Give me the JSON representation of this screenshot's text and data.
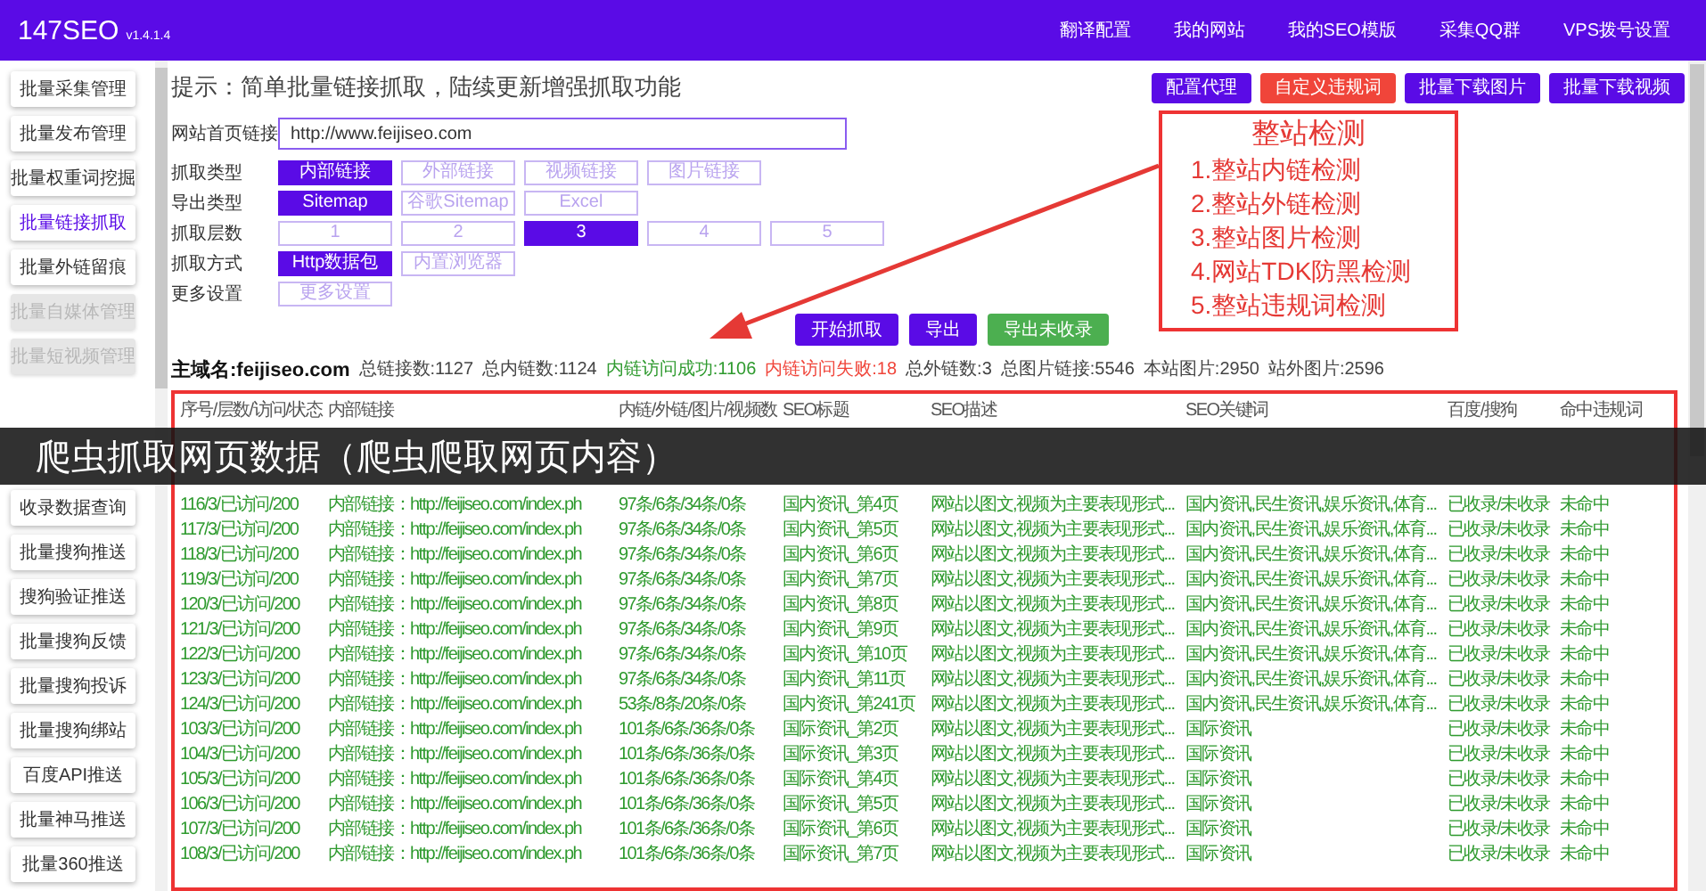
{
  "app": {
    "name": "147SEO",
    "version": "v1.4.1.4"
  },
  "top_nav": [
    "翻译配置",
    "我的网站",
    "我的SEO模版",
    "采集QQ群",
    "VPS拨号设置"
  ],
  "sidebar": {
    "groups": [
      [
        {
          "label": "批量采集管理",
          "selected": false,
          "disabled": false
        },
        {
          "label": "批量发布管理",
          "selected": false,
          "disabled": false
        },
        {
          "label": "批量权重词挖掘",
          "selected": false,
          "disabled": false
        },
        {
          "label": "批量链接抓取",
          "selected": true,
          "disabled": false
        },
        {
          "label": "批量外链留痕",
          "selected": false,
          "disabled": false
        },
        {
          "label": "批量自媒体管理",
          "selected": false,
          "disabled": true
        },
        {
          "label": "批量短视频管理",
          "selected": false,
          "disabled": true
        }
      ],
      [
        {
          "label": "收录数据查询",
          "selected": false,
          "disabled": false
        },
        {
          "label": "批量搜狗推送",
          "selected": false,
          "disabled": false
        },
        {
          "label": "搜狗验证推送",
          "selected": false,
          "disabled": false
        },
        {
          "label": "批量搜狗反馈",
          "selected": false,
          "disabled": false
        },
        {
          "label": "批量搜狗投诉",
          "selected": false,
          "disabled": false
        },
        {
          "label": "批量搜狗绑站",
          "selected": false,
          "disabled": false
        },
        {
          "label": "百度API推送",
          "selected": false,
          "disabled": false
        },
        {
          "label": "批量神马推送",
          "selected": false,
          "disabled": false
        },
        {
          "label": "批量360推送",
          "selected": false,
          "disabled": false
        }
      ]
    ]
  },
  "hint": "提示：简单批量链接抓取，陆续更新增强抓取功能",
  "toolbar": [
    {
      "label": "配置代理",
      "kind": "primary"
    },
    {
      "label": "自定义违规词",
      "kind": "danger"
    },
    {
      "label": "批量下载图片",
      "kind": "primary"
    },
    {
      "label": "批量下载视频",
      "kind": "primary"
    }
  ],
  "url_field": {
    "label": "网站首页链接",
    "value": "http://www.feijiseo.com"
  },
  "options": [
    {
      "label": "抓取类型",
      "choices": [
        {
          "label": "内部链接",
          "selected": true
        },
        {
          "label": "外部链接",
          "selected": false
        },
        {
          "label": "视频链接",
          "selected": false
        },
        {
          "label": "图片链接",
          "selected": false
        }
      ]
    },
    {
      "label": "导出类型",
      "choices": [
        {
          "label": "Sitemap",
          "selected": true
        },
        {
          "label": "谷歌Sitemap",
          "selected": false
        },
        {
          "label": "Excel",
          "selected": false
        }
      ]
    },
    {
      "label": "抓取层数",
      "choices": [
        {
          "label": "1",
          "selected": false
        },
        {
          "label": "2",
          "selected": false
        },
        {
          "label": "3",
          "selected": true
        },
        {
          "label": "4",
          "selected": false
        },
        {
          "label": "5",
          "selected": false
        }
      ]
    },
    {
      "label": "抓取方式",
      "choices": [
        {
          "label": "Http数据包",
          "selected": true
        },
        {
          "label": "内置浏览器",
          "selected": false
        }
      ]
    },
    {
      "label": "更多设置",
      "choices": [
        {
          "label": "更多设置",
          "selected": false
        }
      ]
    }
  ],
  "actions": [
    {
      "label": "开始抓取",
      "kind": "primary"
    },
    {
      "label": "导出",
      "kind": "primary"
    },
    {
      "label": "导出未收录",
      "kind": "success"
    }
  ],
  "stats": [
    {
      "text": "主域名:feijiseo.com",
      "kind": "domain"
    },
    {
      "text": "总链接数:1127",
      "kind": "normal"
    },
    {
      "text": "总内链数:1124",
      "kind": "normal"
    },
    {
      "text": "内链访问成功:1106",
      "kind": "success"
    },
    {
      "text": "内链访问失败:18",
      "kind": "fail"
    },
    {
      "text": "总外链数:3",
      "kind": "normal"
    },
    {
      "text": "总图片链接:5546",
      "kind": "normal"
    },
    {
      "text": "本站图片:2950",
      "kind": "normal"
    },
    {
      "text": "站外图片:2596",
      "kind": "normal"
    }
  ],
  "annotation": {
    "title": "整站检测",
    "items": [
      "1.整站内链检测",
      "2.整站外链检测",
      "3.整站图片检测",
      "4.网站TDK防黑检测",
      "5.整站违规词检测"
    ]
  },
  "caption": "爬虫抓取网页数据（爬虫爬取网页内容）",
  "table": {
    "columns": [
      "序号/层数/访问/状态",
      "内部链接",
      "内链/外链/图片/视频数",
      "SEO标题",
      "SEO描述",
      "SEO关键词",
      "百度/搜狗",
      "命中违规词"
    ],
    "rows": [
      [
        "116/3/已访问/200",
        "内部链接：http://feijiseo.com/index.ph",
        "97条/6条/34条/0条",
        "国内资讯_第4页",
        "网站以图文,视频为主要表现形式...",
        "国内资讯,民生资讯,娱乐资讯,体育...",
        "已收录/未收录",
        "未命中"
      ],
      [
        "117/3/已访问/200",
        "内部链接：http://feijiseo.com/index.ph",
        "97条/6条/34条/0条",
        "国内资讯_第5页",
        "网站以图文,视频为主要表现形式...",
        "国内资讯,民生资讯,娱乐资讯,体育...",
        "已收录/未收录",
        "未命中"
      ],
      [
        "118/3/已访问/200",
        "内部链接：http://feijiseo.com/index.ph",
        "97条/6条/34条/0条",
        "国内资讯_第6页",
        "网站以图文,视频为主要表现形式...",
        "国内资讯,民生资讯,娱乐资讯,体育...",
        "已收录/未收录",
        "未命中"
      ],
      [
        "119/3/已访问/200",
        "内部链接：http://feijiseo.com/index.ph",
        "97条/6条/34条/0条",
        "国内资讯_第7页",
        "网站以图文,视频为主要表现形式...",
        "国内资讯,民生资讯,娱乐资讯,体育...",
        "已收录/未收录",
        "未命中"
      ],
      [
        "120/3/已访问/200",
        "内部链接：http://feijiseo.com/index.ph",
        "97条/6条/34条/0条",
        "国内资讯_第8页",
        "网站以图文,视频为主要表现形式...",
        "国内资讯,民生资讯,娱乐资讯,体育...",
        "已收录/未收录",
        "未命中"
      ],
      [
        "121/3/已访问/200",
        "内部链接：http://feijiseo.com/index.ph",
        "97条/6条/34条/0条",
        "国内资讯_第9页",
        "网站以图文,视频为主要表现形式...",
        "国内资讯,民生资讯,娱乐资讯,体育...",
        "已收录/未收录",
        "未命中"
      ],
      [
        "122/3/已访问/200",
        "内部链接：http://feijiseo.com/index.ph",
        "97条/6条/34条/0条",
        "国内资讯_第10页",
        "网站以图文,视频为主要表现形式...",
        "国内资讯,民生资讯,娱乐资讯,体育...",
        "已收录/未收录",
        "未命中"
      ],
      [
        "123/3/已访问/200",
        "内部链接：http://feijiseo.com/index.ph",
        "97条/6条/34条/0条",
        "国内资讯_第11页",
        "网站以图文,视频为主要表现形式...",
        "国内资讯,民生资讯,娱乐资讯,体育...",
        "已收录/未收录",
        "未命中"
      ],
      [
        "124/3/已访问/200",
        "内部链接：http://feijiseo.com/index.ph",
        "53条/8条/20条/0条",
        "国内资讯_第241页",
        "网站以图文,视频为主要表现形式...",
        "国内资讯,民生资讯,娱乐资讯,体育...",
        "已收录/未收录",
        "未命中"
      ],
      [
        "103/3/已访问/200",
        "内部链接：http://feijiseo.com/index.ph",
        "101条/6条/36条/0条",
        "国际资讯_第2页",
        "网站以图文,视频为主要表现形式...",
        "国际资讯",
        "已收录/未收录",
        "未命中"
      ],
      [
        "104/3/已访问/200",
        "内部链接：http://feijiseo.com/index.ph",
        "101条/6条/36条/0条",
        "国际资讯_第3页",
        "网站以图文,视频为主要表现形式...",
        "国际资讯",
        "已收录/未收录",
        "未命中"
      ],
      [
        "105/3/已访问/200",
        "内部链接：http://feijiseo.com/index.ph",
        "101条/6条/36条/0条",
        "国际资讯_第4页",
        "网站以图文,视频为主要表现形式...",
        "国际资讯",
        "已收录/未收录",
        "未命中"
      ],
      [
        "106/3/已访问/200",
        "内部链接：http://feijiseo.com/index.ph",
        "101条/6条/36条/0条",
        "国际资讯_第5页",
        "网站以图文,视频为主要表现形式...",
        "国际资讯",
        "已收录/未收录",
        "未命中"
      ],
      [
        "107/3/已访问/200",
        "内部链接：http://feijiseo.com/index.ph",
        "101条/6条/36条/0条",
        "国际资讯_第6页",
        "网站以图文,视频为主要表现形式...",
        "国际资讯",
        "已收录/未收录",
        "未命中"
      ],
      [
        "108/3/已访问/200",
        "内部链接：http://feijiseo.com/index.ph",
        "101条/6条/36条/0条",
        "国际资讯_第7页",
        "网站以图文,视频为主要表现形式...",
        "国际资讯",
        "已收录/未收录",
        "未命中"
      ]
    ]
  }
}
